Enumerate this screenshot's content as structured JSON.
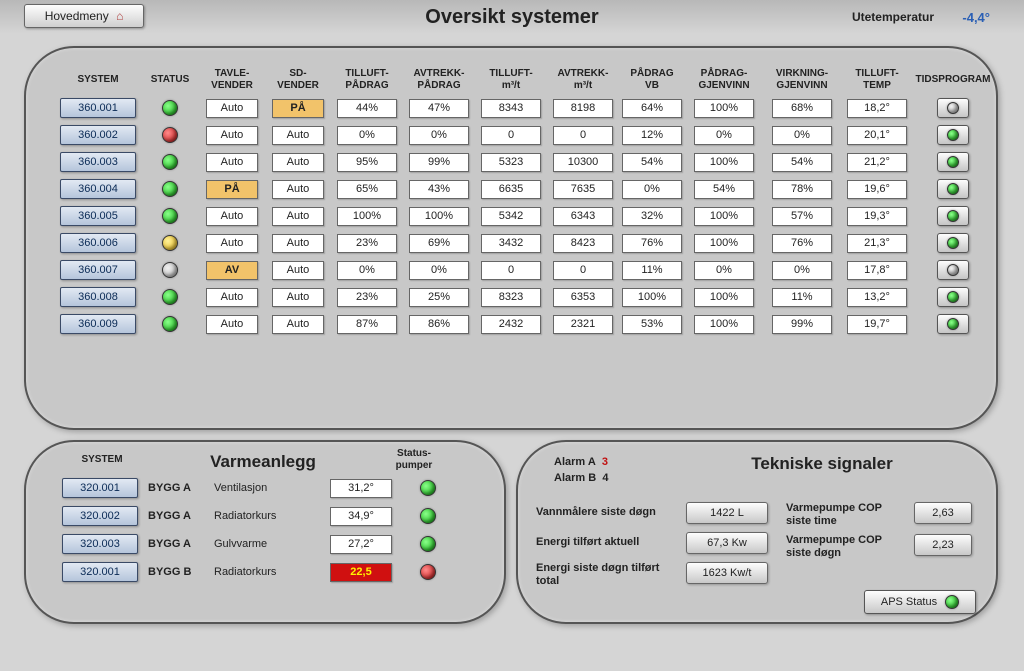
{
  "header": {
    "home_label": "Hovedmeny",
    "title": "Oversikt systemer",
    "outtemp_label": "Utetemperatur",
    "outtemp_value": "-4,4°"
  },
  "columns": {
    "system": "SYSTEM",
    "status": "STATUS",
    "tavle": "TAVLE-\nVENDER",
    "sd": "SD-\nVENDER",
    "tilluft_padrag": "TILLUFT-\nPÅDRAG",
    "avtrekk_padrag": "AVTREKK-\nPÅDRAG",
    "tilluft_m3": "TILLUFT-\nm³/t",
    "avtrekk_m3": "AVTREKK-\nm³/t",
    "padrag_vb": "PÅDRAG\nVB",
    "padrag_gjenvinn": "PÅDRAG-\nGJENVINN",
    "virkning": "VIRKNING-\nGJENVINN",
    "tilluft_temp": "TILLUFT-\nTEMP",
    "tidsprogram": "TIDSPROGRAM"
  },
  "rows": [
    {
      "id": "360.001",
      "status": "green",
      "tavle": "Auto",
      "tavle_on": false,
      "sd": "PÅ",
      "sd_on": true,
      "tp": "44%",
      "ap": "47%",
      "tm": "8343",
      "am": "8198",
      "vb": "64%",
      "pg": "100%",
      "vg": "68%",
      "tt": "18,2°",
      "tpled": "off"
    },
    {
      "id": "360.002",
      "status": "red",
      "tavle": "Auto",
      "tavle_on": false,
      "sd": "Auto",
      "sd_on": false,
      "tp": "0%",
      "ap": "0%",
      "tm": "0",
      "am": "0",
      "vb": "12%",
      "pg": "0%",
      "vg": "0%",
      "tt": "20,1°",
      "tpled": "green"
    },
    {
      "id": "360.003",
      "status": "green",
      "tavle": "Auto",
      "tavle_on": false,
      "sd": "Auto",
      "sd_on": false,
      "tp": "95%",
      "ap": "99%",
      "tm": "5323",
      "am": "10300",
      "vb": "54%",
      "pg": "100%",
      "vg": "54%",
      "tt": "21,2°",
      "tpled": "green"
    },
    {
      "id": "360.004",
      "status": "green",
      "tavle": "PÅ",
      "tavle_on": true,
      "sd": "Auto",
      "sd_on": false,
      "tp": "65%",
      "ap": "43%",
      "tm": "6635",
      "am": "7635",
      "vb": "0%",
      "pg": "54%",
      "vg": "78%",
      "tt": "19,6°",
      "tpled": "green"
    },
    {
      "id": "360.005",
      "status": "green",
      "tavle": "Auto",
      "tavle_on": false,
      "sd": "Auto",
      "sd_on": false,
      "tp": "100%",
      "ap": "100%",
      "tm": "5342",
      "am": "6343",
      "vb": "32%",
      "pg": "100%",
      "vg": "57%",
      "tt": "19,3°",
      "tpled": "green"
    },
    {
      "id": "360.006",
      "status": "yellow",
      "tavle": "Auto",
      "tavle_on": false,
      "sd": "Auto",
      "sd_on": false,
      "tp": "23%",
      "ap": "69%",
      "tm": "3432",
      "am": "8423",
      "vb": "76%",
      "pg": "100%",
      "vg": "76%",
      "tt": "21,3°",
      "tpled": "green"
    },
    {
      "id": "360.007",
      "status": "off",
      "tavle": "AV",
      "tavle_on": true,
      "sd": "Auto",
      "sd_on": false,
      "tp": "0%",
      "ap": "0%",
      "tm": "0",
      "am": "0",
      "vb": "11%",
      "pg": "0%",
      "vg": "0%",
      "tt": "17,8°",
      "tpled": "off"
    },
    {
      "id": "360.008",
      "status": "green",
      "tavle": "Auto",
      "tavle_on": false,
      "sd": "Auto",
      "sd_on": false,
      "tp": "23%",
      "ap": "25%",
      "tm": "8323",
      "am": "6353",
      "vb": "100%",
      "pg": "100%",
      "vg": "11%",
      "tt": "13,2°",
      "tpled": "green"
    },
    {
      "id": "360.009",
      "status": "green",
      "tavle": "Auto",
      "tavle_on": false,
      "sd": "Auto",
      "sd_on": false,
      "tp": "87%",
      "ap": "86%",
      "tm": "2432",
      "am": "2321",
      "vb": "53%",
      "pg": "100%",
      "vg": "99%",
      "tt": "19,7°",
      "tpled": "green"
    }
  ],
  "heating": {
    "title": "Varmeanlegg",
    "system_hdr": "SYSTEM",
    "pump_hdr": "Status-\npumper",
    "rows": [
      {
        "id": "320.001",
        "bygg": "BYGG A",
        "name": "Ventilasjon",
        "val": "31,2°",
        "alarm": false,
        "led": "green"
      },
      {
        "id": "320.002",
        "bygg": "BYGG A",
        "name": "Radiatorkurs",
        "val": "34,9°",
        "alarm": false,
        "led": "green"
      },
      {
        "id": "320.003",
        "bygg": "BYGG A",
        "name": "Gulvvarme",
        "val": "27,2°",
        "alarm": false,
        "led": "green"
      },
      {
        "id": "320.001",
        "bygg": "BYGG B",
        "name": "Radiatorkurs",
        "val": "22,5",
        "alarm": true,
        "led": "red"
      }
    ]
  },
  "tech": {
    "title": "Tekniske signaler",
    "alarm_a_label": "Alarm A",
    "alarm_a_value": "3",
    "alarm_b_label": "Alarm B",
    "alarm_b_value": "4",
    "water_label": "Vannmålere siste døgn",
    "water_value": "1422 L",
    "energy_now_label": "Energi tilført aktuell",
    "energy_now_value": "67,3 Kw",
    "energy_total_label": "Energi siste døgn tilført total",
    "energy_total_value": "1623 Kw/t",
    "cop_hour_label": "Varmepumpe COP siste time",
    "cop_hour_value": "2,63",
    "cop_day_label": "Varmepumpe COP siste døgn",
    "cop_day_value": "2,23",
    "aps_label": "APS Status"
  }
}
